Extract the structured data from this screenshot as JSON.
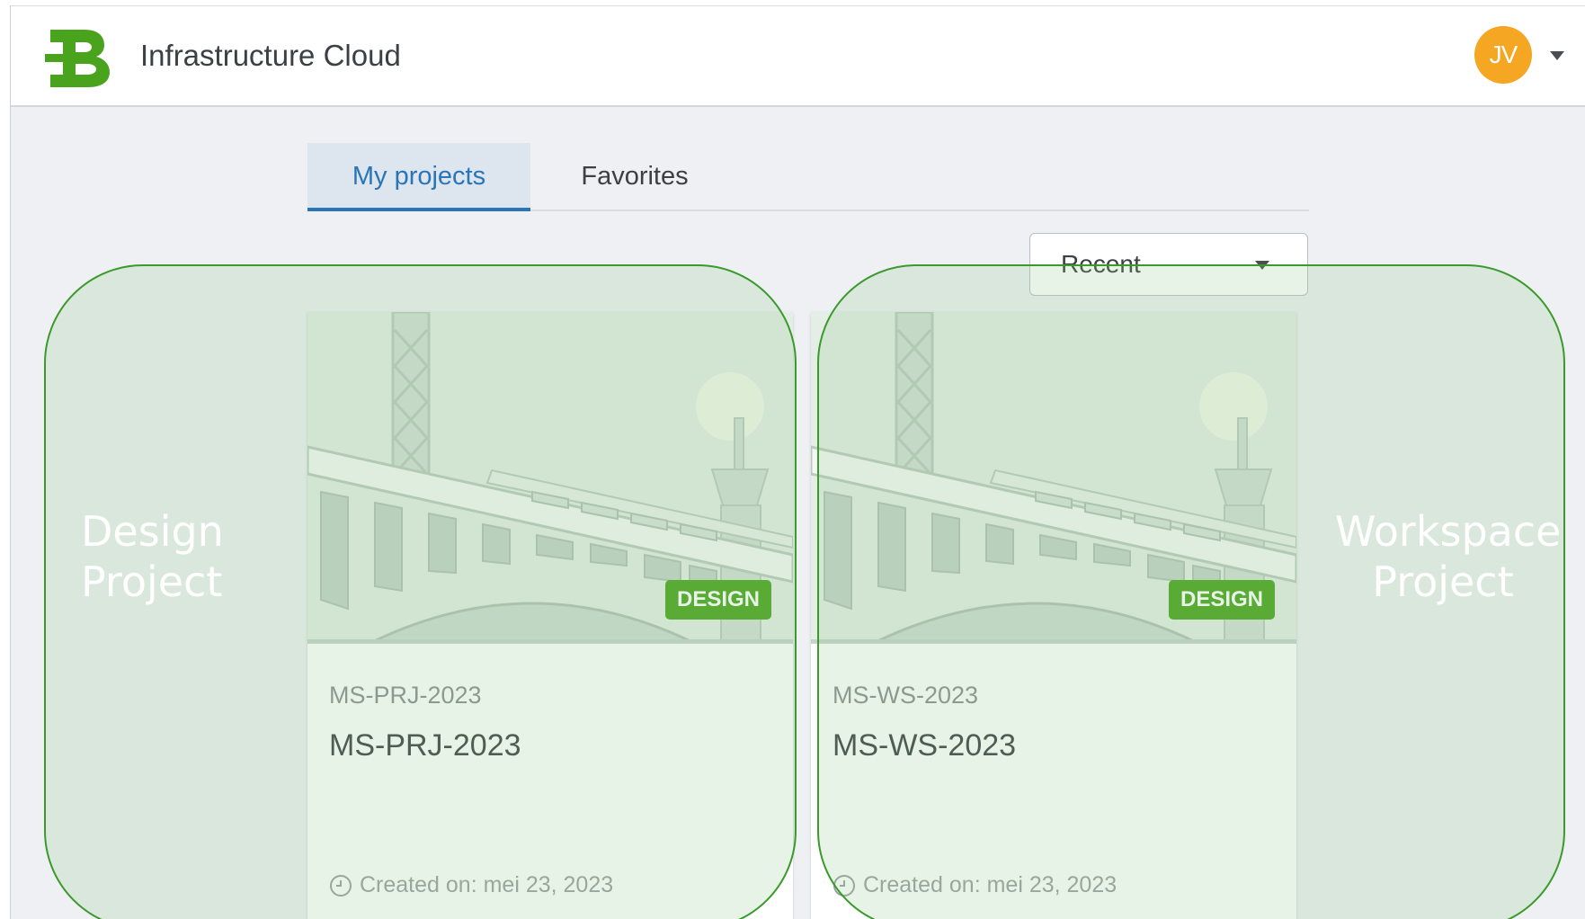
{
  "app": {
    "title": "Infrastructure Cloud",
    "logo": "B"
  },
  "user": {
    "initials": "JV",
    "avatar_color": "#f5a623"
  },
  "tabs": [
    {
      "label": "My projects",
      "active": true
    },
    {
      "label": "Favorites",
      "active": false
    }
  ],
  "sort": {
    "selected": "Recent"
  },
  "projects": [
    {
      "code": "MS-PRJ-2023",
      "name": "MS-PRJ-2023",
      "badge": "DESIGN",
      "created": "Created on: mei 23, 2023"
    },
    {
      "code": "MS-WS-2023",
      "name": "MS-WS-2023",
      "badge": "DESIGN",
      "created": "Created on: mei 23, 2023"
    }
  ],
  "annotations": [
    {
      "line1": "Design",
      "line2": "Project"
    },
    {
      "line1": "Workspace",
      "line2": "Project"
    }
  ],
  "colors": {
    "brand_green": "#4aa31d",
    "tab_active": "#2a74b8",
    "highlight_outline": "#3a9a2a"
  },
  "icons": [
    "logo-b-icon",
    "chevron-down-icon",
    "clock-icon",
    "bridge-illustration"
  ]
}
